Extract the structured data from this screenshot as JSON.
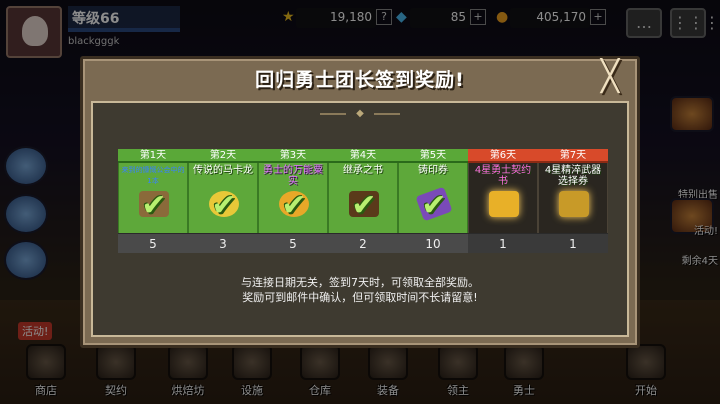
{
  "hud": {
    "level_label": "等级66",
    "username": "blackgggk",
    "stat1": "19,180",
    "stat1_icon": "★",
    "stat2": "85",
    "stat2_icon": "◆",
    "stat3": "405,170",
    "stat3_icon": "●",
    "plus": "+",
    "help": "?",
    "chat_icon": "…",
    "menu_icon": "⋮⋮⋮"
  },
  "side": {
    "right_label_1": "特别出售",
    "right_label_2": "活动!",
    "right_label_3": "剩余4天"
  },
  "activity_tag": "活动!",
  "bottom_nav": [
    {
      "label": "商店"
    },
    {
      "label": "契约"
    },
    {
      "label": "烘焙坊"
    },
    {
      "label": "设施"
    },
    {
      "label": "仓库"
    },
    {
      "label": "装备"
    },
    {
      "label": "领主"
    },
    {
      "label": "勇士"
    },
    {
      "label": "开始"
    }
  ],
  "modal": {
    "title": "回归勇士团长签到奖励!",
    "close": "╳",
    "notice_line1": "与连接日期无关，签到7天时，可领取全部奖励。",
    "notice_line2": "奖励可到邮件中确认，但可领取时间不长请留意!"
  },
  "days": [
    {
      "day": "第1天",
      "name": "来到的慷慨公会中的1本",
      "count": "5",
      "claimed": true,
      "special": false,
      "color": "#8a6a3a"
    },
    {
      "day": "第2天",
      "name": "传说的马卡龙",
      "count": "3",
      "claimed": true,
      "special": false,
      "color": "#e8c838"
    },
    {
      "day": "第3天",
      "name": "勇士的万能粟实",
      "count": "5",
      "claimed": true,
      "special": false,
      "color": "#e8a828"
    },
    {
      "day": "第4天",
      "name": "继承之书",
      "count": "2",
      "claimed": true,
      "special": false,
      "color": "#5a3a1a"
    },
    {
      "day": "第5天",
      "name": "铸印券",
      "count": "10",
      "claimed": true,
      "special": false,
      "color": "#7a4ab8"
    },
    {
      "day": "第6天",
      "name": "4星勇士契约书",
      "count": "1",
      "claimed": false,
      "special": true,
      "color": "#e8b028"
    },
    {
      "day": "第7天",
      "name": "4星精淬武器选择券",
      "count": "1",
      "claimed": false,
      "special": true,
      "color": "#c89a28"
    }
  ]
}
